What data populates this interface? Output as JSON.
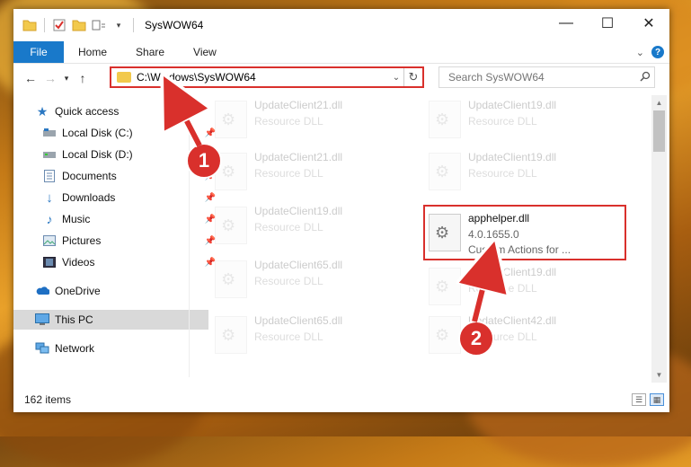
{
  "window": {
    "title": "SysWOW64",
    "controls": {
      "minimize": "—",
      "maximize": "☐",
      "close": "✕"
    }
  },
  "ribbon": {
    "tabs": [
      "File",
      "Home",
      "Share",
      "View"
    ],
    "expand_icon": "chevron-down-icon",
    "help_label": "?"
  },
  "nav": {
    "address_path": "C:\\Windows\\SysWOW64",
    "search_placeholder": "Search SysWOW64"
  },
  "sidebar": {
    "items": [
      {
        "label": "Quick access",
        "icon": "star-icon",
        "pinned": false
      },
      {
        "label": "Local Disk (C:)",
        "icon": "drive-icon",
        "pinned": true
      },
      {
        "label": "Local Disk (D:)",
        "icon": "drive-icon",
        "pinned": true
      },
      {
        "label": "Documents",
        "icon": "documents-icon",
        "pinned": true
      },
      {
        "label": "Downloads",
        "icon": "download-icon",
        "pinned": true
      },
      {
        "label": "Music",
        "icon": "music-icon",
        "pinned": true
      },
      {
        "label": "Pictures",
        "icon": "pictures-icon",
        "pinned": true
      },
      {
        "label": "Videos",
        "icon": "videos-icon",
        "pinned": true
      },
      {
        "label": "OneDrive",
        "icon": "cloud-icon",
        "pinned": false
      },
      {
        "label": "This PC",
        "icon": "computer-icon",
        "pinned": false,
        "selected": true
      },
      {
        "label": "Network",
        "icon": "network-icon",
        "pinned": false
      }
    ]
  },
  "files": [
    {
      "name": "UpdateClient21.dll",
      "type": "Resource DLL",
      "faded": true
    },
    {
      "name": "UpdateClient19.dll",
      "type": "Resource DLL",
      "faded": true
    },
    {
      "name": "UpdateClient21.dll",
      "type": "Resource DLL",
      "faded": true
    },
    {
      "name": "UpdateClient19.dll",
      "type": "Resource DLL",
      "faded": true
    },
    {
      "name": "UpdateClient19.dll",
      "type": "Resource DLL",
      "faded": true
    },
    {
      "name": "apphelper.dll",
      "type": "4.0.1655.0",
      "desc": "Custom Actions for ...",
      "faded": false
    },
    {
      "name": "UpdateClient65.dll",
      "type": "Resource DLL",
      "faded": true
    },
    {
      "name": "UpdateClient19.dll",
      "type": "Resource DLL",
      "faded": true
    },
    {
      "name": "UpdateClient65.dll",
      "type": "Resource DLL",
      "faded": true
    },
    {
      "name": "UpdateClient42.dll",
      "type": "Resource DLL",
      "faded": true
    }
  ],
  "status": {
    "item_count": "162 items"
  },
  "annotations": {
    "callout_1": "1",
    "callout_2": "2",
    "color": "#d9302c"
  }
}
